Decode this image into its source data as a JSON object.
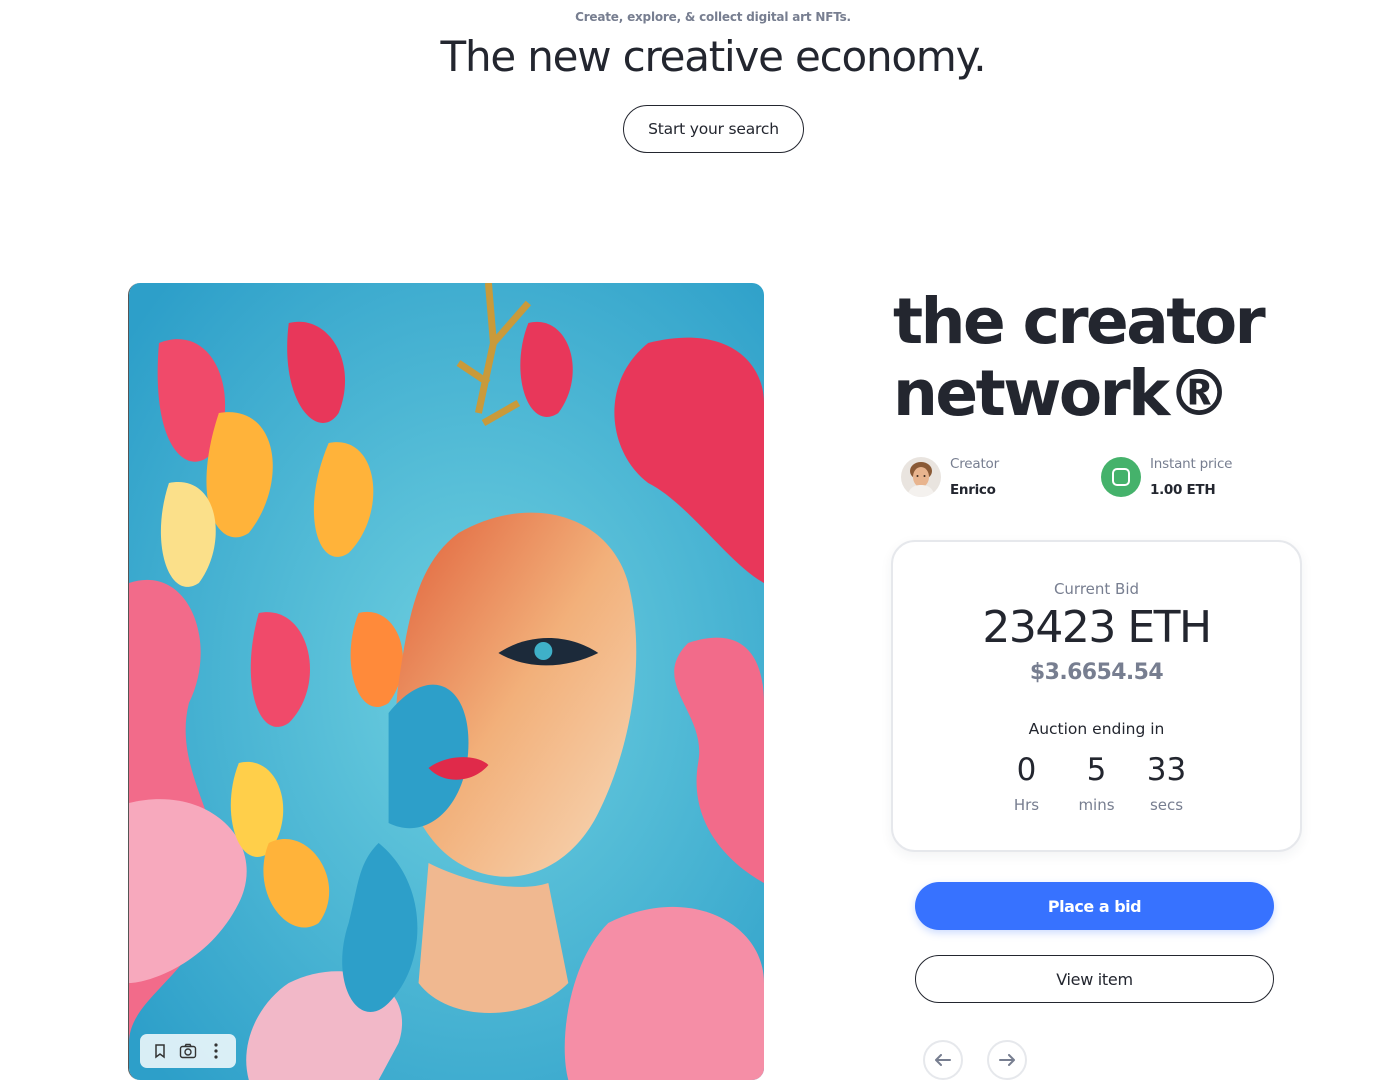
{
  "hero": {
    "eyebrow": "Create, explore, & collect digital art NFTs.",
    "title": "The new creative economy.",
    "search_button": "Start your search"
  },
  "item": {
    "title_line1": "the creator",
    "title_line2": "network®",
    "creator_label": "Creator",
    "creator_name": "Enrico",
    "price_label": "Instant price",
    "price_value": "1.00 ETH"
  },
  "bid": {
    "label": "Current Bid",
    "eth": "23423 ETH",
    "usd": "$3.6654.54",
    "auction_label": "Auction ending in",
    "countdown": [
      {
        "value": "0",
        "unit": "Hrs"
      },
      {
        "value": "5",
        "unit": "mins"
      },
      {
        "value": "33",
        "unit": "secs"
      }
    ]
  },
  "actions": {
    "place_bid": "Place a bid",
    "view_item": "View item"
  },
  "icons": {
    "artwork_toolbar": [
      "bookmark-icon",
      "camera-search-icon",
      "more-vertical-icon"
    ],
    "nav": [
      "arrow-left-icon",
      "arrow-right-icon"
    ]
  },
  "colors": {
    "primary": "#3772ff",
    "price_icon": "#45b26b",
    "text": "#23262f",
    "muted": "#777e90"
  }
}
